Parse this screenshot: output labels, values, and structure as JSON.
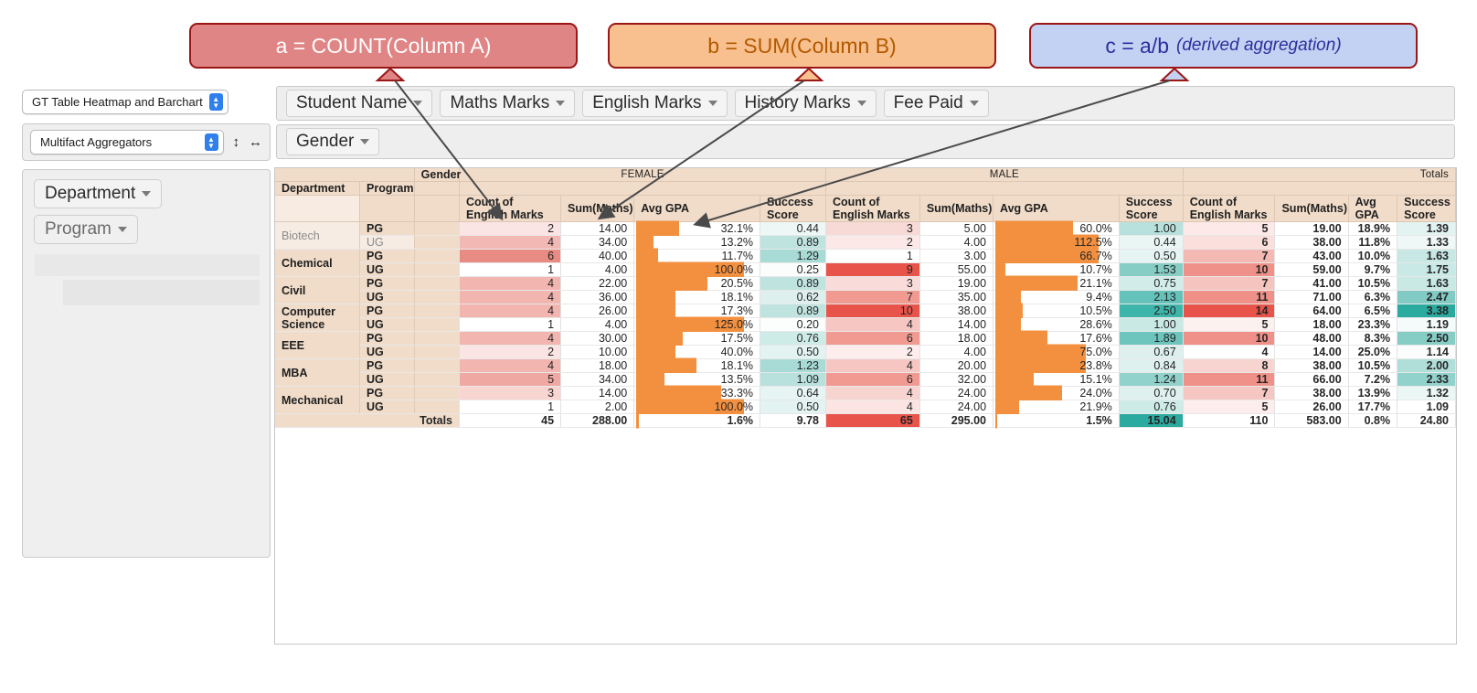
{
  "callouts": [
    {
      "id": "a",
      "text": "a = COUNT(Column A)",
      "italic": "",
      "bg": "#e08585",
      "color": "#ffffff"
    },
    {
      "id": "b",
      "text": "b = SUM(Column B)",
      "italic": "",
      "bg": "#f7c08e",
      "color": "#b35900"
    },
    {
      "id": "c",
      "text": "c = a/b",
      "italic": "(derived aggregation)",
      "bg": "#c3d2f2",
      "color": "#2b2f9e"
    }
  ],
  "left_panel": {
    "source_select": "GT Table Heatmap and Barchart",
    "aggregator_select": "Multifact Aggregators",
    "resize_v_icon": "resize-vertical-icon",
    "resize_h_icon": "resize-horizontal-icon",
    "drop_pills": [
      {
        "label": "Department",
        "dim": false
      },
      {
        "label": "Program",
        "dim": true
      }
    ]
  },
  "field_bars": {
    "row1": [
      "Student Name",
      "Maths Marks",
      "English Marks",
      "History Marks",
      "Fee Paid"
    ],
    "row2": [
      "Gender"
    ]
  },
  "table": {
    "corner_gender_label": "Gender",
    "row_headers": [
      "Department",
      "Program"
    ],
    "groups": [
      {
        "name": "FEMALE",
        "cols": [
          "Count of English Marks",
          "Sum(Maths)",
          "Avg GPA",
          "Success Score"
        ]
      },
      {
        "name": "MALE",
        "cols": [
          "Count of English Marks",
          "Sum(Maths)",
          "Avg GPA",
          "Success Score"
        ]
      },
      {
        "name": "Totals",
        "cols": [
          "Count of English Marks",
          "Sum(Maths)",
          "Avg GPA",
          "Success Score"
        ]
      }
    ],
    "totals_label": "Totals",
    "rows": [
      {
        "dept": "Biotech",
        "dept_dim": true,
        "prog": "PG",
        "prog_dim": false,
        "f": {
          "count": "2",
          "sum": "14.00",
          "gpa": "32.1%",
          "gpa_w": 40,
          "score": "0.44"
        },
        "m": {
          "count": "3",
          "sum": "5.00",
          "gpa": "60.0%",
          "gpa_w": 72,
          "score": "1.00"
        },
        "t": {
          "count": "5",
          "sum": "19.00",
          "gpa": "18.9%",
          "score": "1.39"
        },
        "c": {
          "f_count": "#fbe4e4",
          "f_score": "#ecf7f6",
          "m_count": "#f7d9d6",
          "m_score": "#b8e0dc",
          "t_count": "#fce9e8",
          "t_score": "#e3f3f1"
        }
      },
      {
        "dept": "Biotech",
        "dept_dim": true,
        "prog": "UG",
        "prog_dim": true,
        "f": {
          "count": "4",
          "sum": "34.00",
          "gpa": "13.2%",
          "gpa_w": 16,
          "score": "0.89"
        },
        "m": {
          "count": "2",
          "sum": "4.00",
          "gpa": "112.5%",
          "gpa_w": 96,
          "score": "0.44"
        },
        "t": {
          "count": "6",
          "sum": "38.00",
          "gpa": "11.8%",
          "score": "1.33"
        },
        "c": {
          "f_count": "#f2b8b4",
          "f_score": "#bfe3df",
          "m_count": "#fce8e7",
          "m_score": "#eaf6f4",
          "t_count": "#fbdfdd",
          "t_score": "#f0f8f7"
        }
      },
      {
        "dept": "Chemical",
        "dept_dim": false,
        "prog": "PG",
        "prog_dim": false,
        "f": {
          "count": "6",
          "sum": "40.00",
          "gpa": "11.7%",
          "gpa_w": 20,
          "score": "1.29"
        },
        "m": {
          "count": "1",
          "sum": "3.00",
          "gpa": "66.7%",
          "gpa_w": 96,
          "score": "0.50"
        },
        "t": {
          "count": "7",
          "sum": "43.00",
          "gpa": "10.0%",
          "score": "1.63"
        },
        "c": {
          "f_count": "#e88b82",
          "f_score": "#a8dbd6",
          "m_count": "#ffffff",
          "m_score": "#e6f5f3",
          "t_count": "#f4b9b3",
          "t_score": "#c7e8e4"
        }
      },
      {
        "dept": "Chemical",
        "dept_dim": false,
        "prog": "UG",
        "prog_dim": false,
        "f": {
          "count": "1",
          "sum": "4.00",
          "gpa": "100.0%",
          "gpa_w": 100,
          "score": "0.25"
        },
        "m": {
          "count": "9",
          "sum": "55.00",
          "gpa": "10.7%",
          "gpa_w": 9,
          "score": "1.53"
        },
        "t": {
          "count": "10",
          "sum": "59.00",
          "gpa": "9.7%",
          "score": "1.75"
        },
        "c": {
          "f_count": "#ffffff",
          "f_score": "#fbfdfd",
          "m_count": "#e8534a",
          "m_score": "#86cdc6",
          "t_count": "#ef9188",
          "t_score": "#c8e9e5"
        }
      },
      {
        "dept": "Civil",
        "dept_dim": false,
        "prog": "PG",
        "prog_dim": false,
        "f": {
          "count": "4",
          "sum": "22.00",
          "gpa": "20.5%",
          "gpa_w": 66,
          "score": "0.89"
        },
        "m": {
          "count": "3",
          "sum": "19.00",
          "gpa": "21.1%",
          "gpa_w": 76,
          "score": "0.75"
        },
        "t": {
          "count": "7",
          "sum": "41.00",
          "gpa": "10.5%",
          "score": "1.63"
        },
        "c": {
          "f_count": "#f2b5b0",
          "f_score": "#bfe3df",
          "m_count": "#f9dcd9",
          "m_score": "#d1ece9",
          "t_count": "#f6c4bf",
          "t_score": "#c9e9e5"
        }
      },
      {
        "dept": "Civil",
        "dept_dim": false,
        "prog": "UG",
        "prog_dim": false,
        "f": {
          "count": "4",
          "sum": "36.00",
          "gpa": "18.1%",
          "gpa_w": 36,
          "score": "0.62"
        },
        "m": {
          "count": "7",
          "sum": "35.00",
          "gpa": "9.4%",
          "gpa_w": 24,
          "score": "2.13"
        },
        "t": {
          "count": "11",
          "sum": "71.00",
          "gpa": "6.3%",
          "score": "2.47"
        },
        "c": {
          "f_count": "#f2b5b0",
          "f_score": "#ddf0ee",
          "m_count": "#f09a92",
          "m_score": "#64c2ba",
          "t_count": "#ef9188",
          "t_score": "#81cbc4"
        }
      },
      {
        "dept": "Computer Science",
        "dept_dim": false,
        "prog": "PG",
        "prog_dim": false,
        "f": {
          "count": "4",
          "sum": "26.00",
          "gpa": "17.3%",
          "gpa_w": 36,
          "score": "0.89"
        },
        "m": {
          "count": "10",
          "sum": "38.00",
          "gpa": "10.5%",
          "gpa_w": 25,
          "score": "2.50"
        },
        "t": {
          "count": "14",
          "sum": "64.00",
          "gpa": "6.5%",
          "score": "3.38"
        },
        "c": {
          "f_count": "#f2b5b0",
          "f_score": "#bfe3df",
          "m_count": "#e8534a",
          "m_score": "#3db5aa",
          "t_count": "#e8534a",
          "t_score": "#2bab9f"
        }
      },
      {
        "dept": "Computer Science",
        "dept_dim": false,
        "prog": "UG",
        "prog_dim": false,
        "f": {
          "count": "1",
          "sum": "4.00",
          "gpa": "125.0%",
          "gpa_w": 100,
          "score": "0.20"
        },
        "m": {
          "count": "4",
          "sum": "14.00",
          "gpa": "28.6%",
          "gpa_w": 24,
          "score": "1.00"
        },
        "t": {
          "count": "5",
          "sum": "18.00",
          "gpa": "23.3%",
          "score": "1.19"
        },
        "c": {
          "f_count": "#ffffff",
          "f_score": "#fcfefe",
          "m_count": "#f6c7c2",
          "m_score": "#c9e9e5",
          "t_count": "#fdf1f0",
          "t_score": "#f5fbfa"
        }
      },
      {
        "dept": "EEE",
        "dept_dim": false,
        "prog": "PG",
        "prog_dim": false,
        "f": {
          "count": "4",
          "sum": "30.00",
          "gpa": "17.5%",
          "gpa_w": 43,
          "score": "0.76"
        },
        "m": {
          "count": "6",
          "sum": "18.00",
          "gpa": "17.6%",
          "gpa_w": 48,
          "score": "1.89"
        },
        "t": {
          "count": "10",
          "sum": "48.00",
          "gpa": "8.3%",
          "score": "2.50"
        },
        "c": {
          "f_count": "#f2b5b0",
          "f_score": "#cdebe7",
          "m_count": "#f09a92",
          "m_score": "#6ec5be",
          "t_count": "#ef9188",
          "t_score": "#86cdc6"
        }
      },
      {
        "dept": "EEE",
        "dept_dim": false,
        "prog": "UG",
        "prog_dim": false,
        "f": {
          "count": "2",
          "sum": "10.00",
          "gpa": "40.0%",
          "gpa_w": 36,
          "score": "0.50"
        },
        "m": {
          "count": "2",
          "sum": "4.00",
          "gpa": "75.0%",
          "gpa_w": 84,
          "score": "0.67"
        },
        "t": {
          "count": "4",
          "sum": "14.00",
          "gpa": "25.0%",
          "score": "1.14"
        },
        "c": {
          "f_count": "#fbe4e4",
          "f_score": "#e3f3f1",
          "m_count": "#fdeeed",
          "m_score": "#ddf0ee",
          "t_count": "#ffffff",
          "t_score": "#fbfdfd"
        }
      },
      {
        "dept": "MBA",
        "dept_dim": false,
        "prog": "PG",
        "prog_dim": false,
        "f": {
          "count": "4",
          "sum": "18.00",
          "gpa": "18.1%",
          "gpa_w": 56,
          "score": "1.23"
        },
        "m": {
          "count": "4",
          "sum": "20.00",
          "gpa": "23.8%",
          "gpa_w": 84,
          "score": "0.84"
        },
        "t": {
          "count": "8",
          "sum": "38.00",
          "gpa": "10.5%",
          "score": "2.00"
        },
        "c": {
          "f_count": "#f2b5b0",
          "f_score": "#a8dbd6",
          "m_count": "#f6c7c2",
          "m_score": "#dff1ef",
          "t_count": "#f8d4d0",
          "t_score": "#b0ded9"
        }
      },
      {
        "dept": "MBA",
        "dept_dim": false,
        "prog": "UG",
        "prog_dim": false,
        "f": {
          "count": "5",
          "sum": "34.00",
          "gpa": "13.5%",
          "gpa_w": 26,
          "score": "1.09"
        },
        "m": {
          "count": "6",
          "sum": "32.00",
          "gpa": "15.1%",
          "gpa_w": 36,
          "score": "1.24"
        },
        "t": {
          "count": "11",
          "sum": "66.00",
          "gpa": "7.2%",
          "score": "2.33"
        },
        "c": {
          "f_count": "#efa8a2",
          "f_score": "#b8e0dc",
          "m_count": "#f09a92",
          "m_score": "#92d2cc",
          "t_count": "#ef9188",
          "t_score": "#92d2cc"
        }
      },
      {
        "dept": "Mechanical",
        "dept_dim": false,
        "prog": "PG",
        "prog_dim": false,
        "f": {
          "count": "3",
          "sum": "14.00",
          "gpa": "33.3%",
          "gpa_w": 79,
          "score": "0.64"
        },
        "m": {
          "count": "4",
          "sum": "24.00",
          "gpa": "24.0%",
          "gpa_w": 62,
          "score": "0.70"
        },
        "t": {
          "count": "7",
          "sum": "38.00",
          "gpa": "13.9%",
          "score": "1.32"
        },
        "c": {
          "f_count": "#f9d5d2",
          "f_score": "#e6f5f3",
          "m_count": "#f8d4d0",
          "m_score": "#dff1ef",
          "t_count": "#f6c7c2",
          "t_score": "#eaf7f5"
        }
      },
      {
        "dept": "Mechanical",
        "dept_dim": false,
        "prog": "UG",
        "prog_dim": false,
        "f": {
          "count": "1",
          "sum": "2.00",
          "gpa": "100.0%",
          "gpa_w": 100,
          "score": "0.50"
        },
        "m": {
          "count": "4",
          "sum": "24.00",
          "gpa": "21.9%",
          "gpa_w": 22,
          "score": "0.76"
        },
        "t": {
          "count": "5",
          "sum": "26.00",
          "gpa": "17.7%",
          "score": "1.09"
        },
        "c": {
          "f_count": "#ffffff",
          "f_score": "#e3f3f1",
          "m_count": "#fbe4e2",
          "m_score": "#cdebe7",
          "t_count": "#fdeeed",
          "t_score": "#ffffff"
        }
      }
    ],
    "totals_row": {
      "label": "Totals",
      "f": {
        "count": "45",
        "sum": "288.00",
        "gpa": "1.6%",
        "gpa_w": 2,
        "score": "9.78"
      },
      "m": {
        "count": "65",
        "sum": "295.00",
        "gpa": "1.5%",
        "gpa_w": 2,
        "score": "15.04"
      },
      "t": {
        "count": "110",
        "sum": "583.00",
        "gpa": "0.8%",
        "score": "24.80"
      },
      "c": {
        "m_count": "#e8534a",
        "m_score": "#2bab9f"
      }
    }
  },
  "chart_data": {
    "type": "table",
    "title": "Multifact Aggregators — GT Table Heatmap and Barchart",
    "row_dimensions": [
      "Department",
      "Program"
    ],
    "column_dimension": "Gender",
    "column_groups": [
      "FEMALE",
      "MALE",
      "Totals"
    ],
    "measures": [
      "Count of English Marks",
      "Sum(Maths)",
      "Avg GPA",
      "Success Score"
    ],
    "categories": [
      "Biotech/PG",
      "Biotech/UG",
      "Chemical/PG",
      "Chemical/UG",
      "Civil/PG",
      "Civil/UG",
      "Computer Science/PG",
      "Computer Science/UG",
      "EEE/PG",
      "EEE/UG",
      "MBA/PG",
      "MBA/UG",
      "Mechanical/PG",
      "Mechanical/UG",
      "Totals"
    ],
    "series": [
      {
        "name": "FEMALE Count of English Marks",
        "values": [
          2,
          4,
          6,
          1,
          4,
          4,
          4,
          1,
          4,
          2,
          4,
          5,
          3,
          1,
          45
        ]
      },
      {
        "name": "FEMALE Sum(Maths)",
        "values": [
          14.0,
          34.0,
          40.0,
          4.0,
          22.0,
          36.0,
          26.0,
          4.0,
          30.0,
          10.0,
          18.0,
          34.0,
          14.0,
          2.0,
          288.0
        ]
      },
      {
        "name": "FEMALE Avg GPA (%)",
        "values": [
          32.1,
          13.2,
          11.7,
          100.0,
          20.5,
          18.1,
          17.3,
          125.0,
          17.5,
          40.0,
          18.1,
          13.5,
          33.3,
          100.0,
          1.6
        ]
      },
      {
        "name": "FEMALE Success Score",
        "values": [
          0.44,
          0.89,
          1.29,
          0.25,
          0.89,
          0.62,
          0.89,
          0.2,
          0.76,
          0.5,
          1.23,
          1.09,
          0.64,
          0.5,
          9.78
        ]
      },
      {
        "name": "MALE Count of English Marks",
        "values": [
          3,
          2,
          1,
          9,
          3,
          7,
          10,
          4,
          6,
          2,
          4,
          6,
          4,
          4,
          65
        ]
      },
      {
        "name": "MALE Sum(Maths)",
        "values": [
          5.0,
          4.0,
          3.0,
          55.0,
          19.0,
          35.0,
          38.0,
          14.0,
          18.0,
          4.0,
          20.0,
          32.0,
          24.0,
          24.0,
          295.0
        ]
      },
      {
        "name": "MALE Avg GPA (%)",
        "values": [
          60.0,
          112.5,
          66.7,
          10.7,
          21.1,
          9.4,
          10.5,
          28.6,
          17.6,
          75.0,
          23.8,
          15.1,
          24.0,
          21.9,
          1.5
        ]
      },
      {
        "name": "MALE Success Score",
        "values": [
          1.0,
          0.44,
          0.5,
          1.53,
          0.75,
          2.13,
          2.5,
          1.0,
          1.89,
          0.67,
          0.84,
          1.24,
          0.7,
          0.76,
          15.04
        ]
      },
      {
        "name": "Totals Count of English Marks",
        "values": [
          5,
          6,
          7,
          10,
          7,
          11,
          14,
          5,
          10,
          4,
          8,
          11,
          7,
          5,
          110
        ]
      },
      {
        "name": "Totals Sum(Maths)",
        "values": [
          19.0,
          38.0,
          43.0,
          59.0,
          41.0,
          71.0,
          64.0,
          18.0,
          48.0,
          14.0,
          38.0,
          66.0,
          38.0,
          26.0,
          583.0
        ]
      },
      {
        "name": "Totals Avg GPA (%)",
        "values": [
          18.9,
          11.8,
          10.0,
          9.7,
          10.5,
          6.3,
          6.5,
          23.3,
          8.3,
          25.0,
          10.5,
          7.2,
          13.9,
          17.7,
          0.8
        ]
      },
      {
        "name": "Totals Success Score",
        "values": [
          1.39,
          1.33,
          1.63,
          1.75,
          1.63,
          2.47,
          3.38,
          1.19,
          2.5,
          1.14,
          2.0,
          2.33,
          1.32,
          1.09,
          24.8
        ]
      }
    ],
    "bar_color": "#f3903f",
    "heat_low_color": "#ffffff",
    "heat_count_high_color": "#e8534a",
    "heat_score_high_color": "#2bab9f"
  }
}
